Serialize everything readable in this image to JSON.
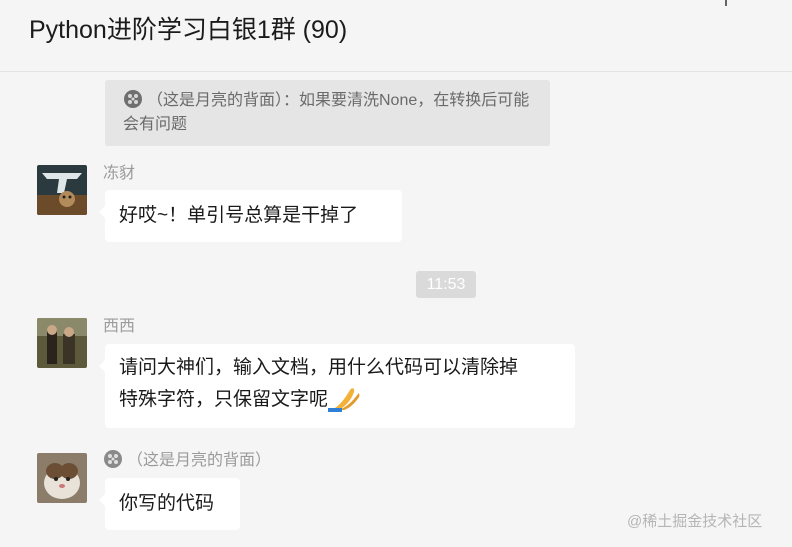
{
  "header": {
    "title": "Python进阶学习白银1群 (90)"
  },
  "icons": {
    "pin": "pin-icon",
    "moon": "moon-icon",
    "pray": "praying-hands-emoji"
  },
  "quote": {
    "text": "（这是月亮的背面）：如果要清洗None，在转换后可能会有问题"
  },
  "messages": [
    {
      "sender": "冻豺",
      "text": "好哎~！单引号总算是干掉了"
    },
    {
      "sender": "西西",
      "text_line1": "请问大神们，输入文档，用什么代码可以清除掉",
      "text_line2": "特殊字符，只保留文字呢"
    },
    {
      "sender": "（这是月亮的背面）",
      "text": "你写的代码"
    }
  ],
  "timestamp": "11:53",
  "watermark": "@稀土掘金技术社区"
}
